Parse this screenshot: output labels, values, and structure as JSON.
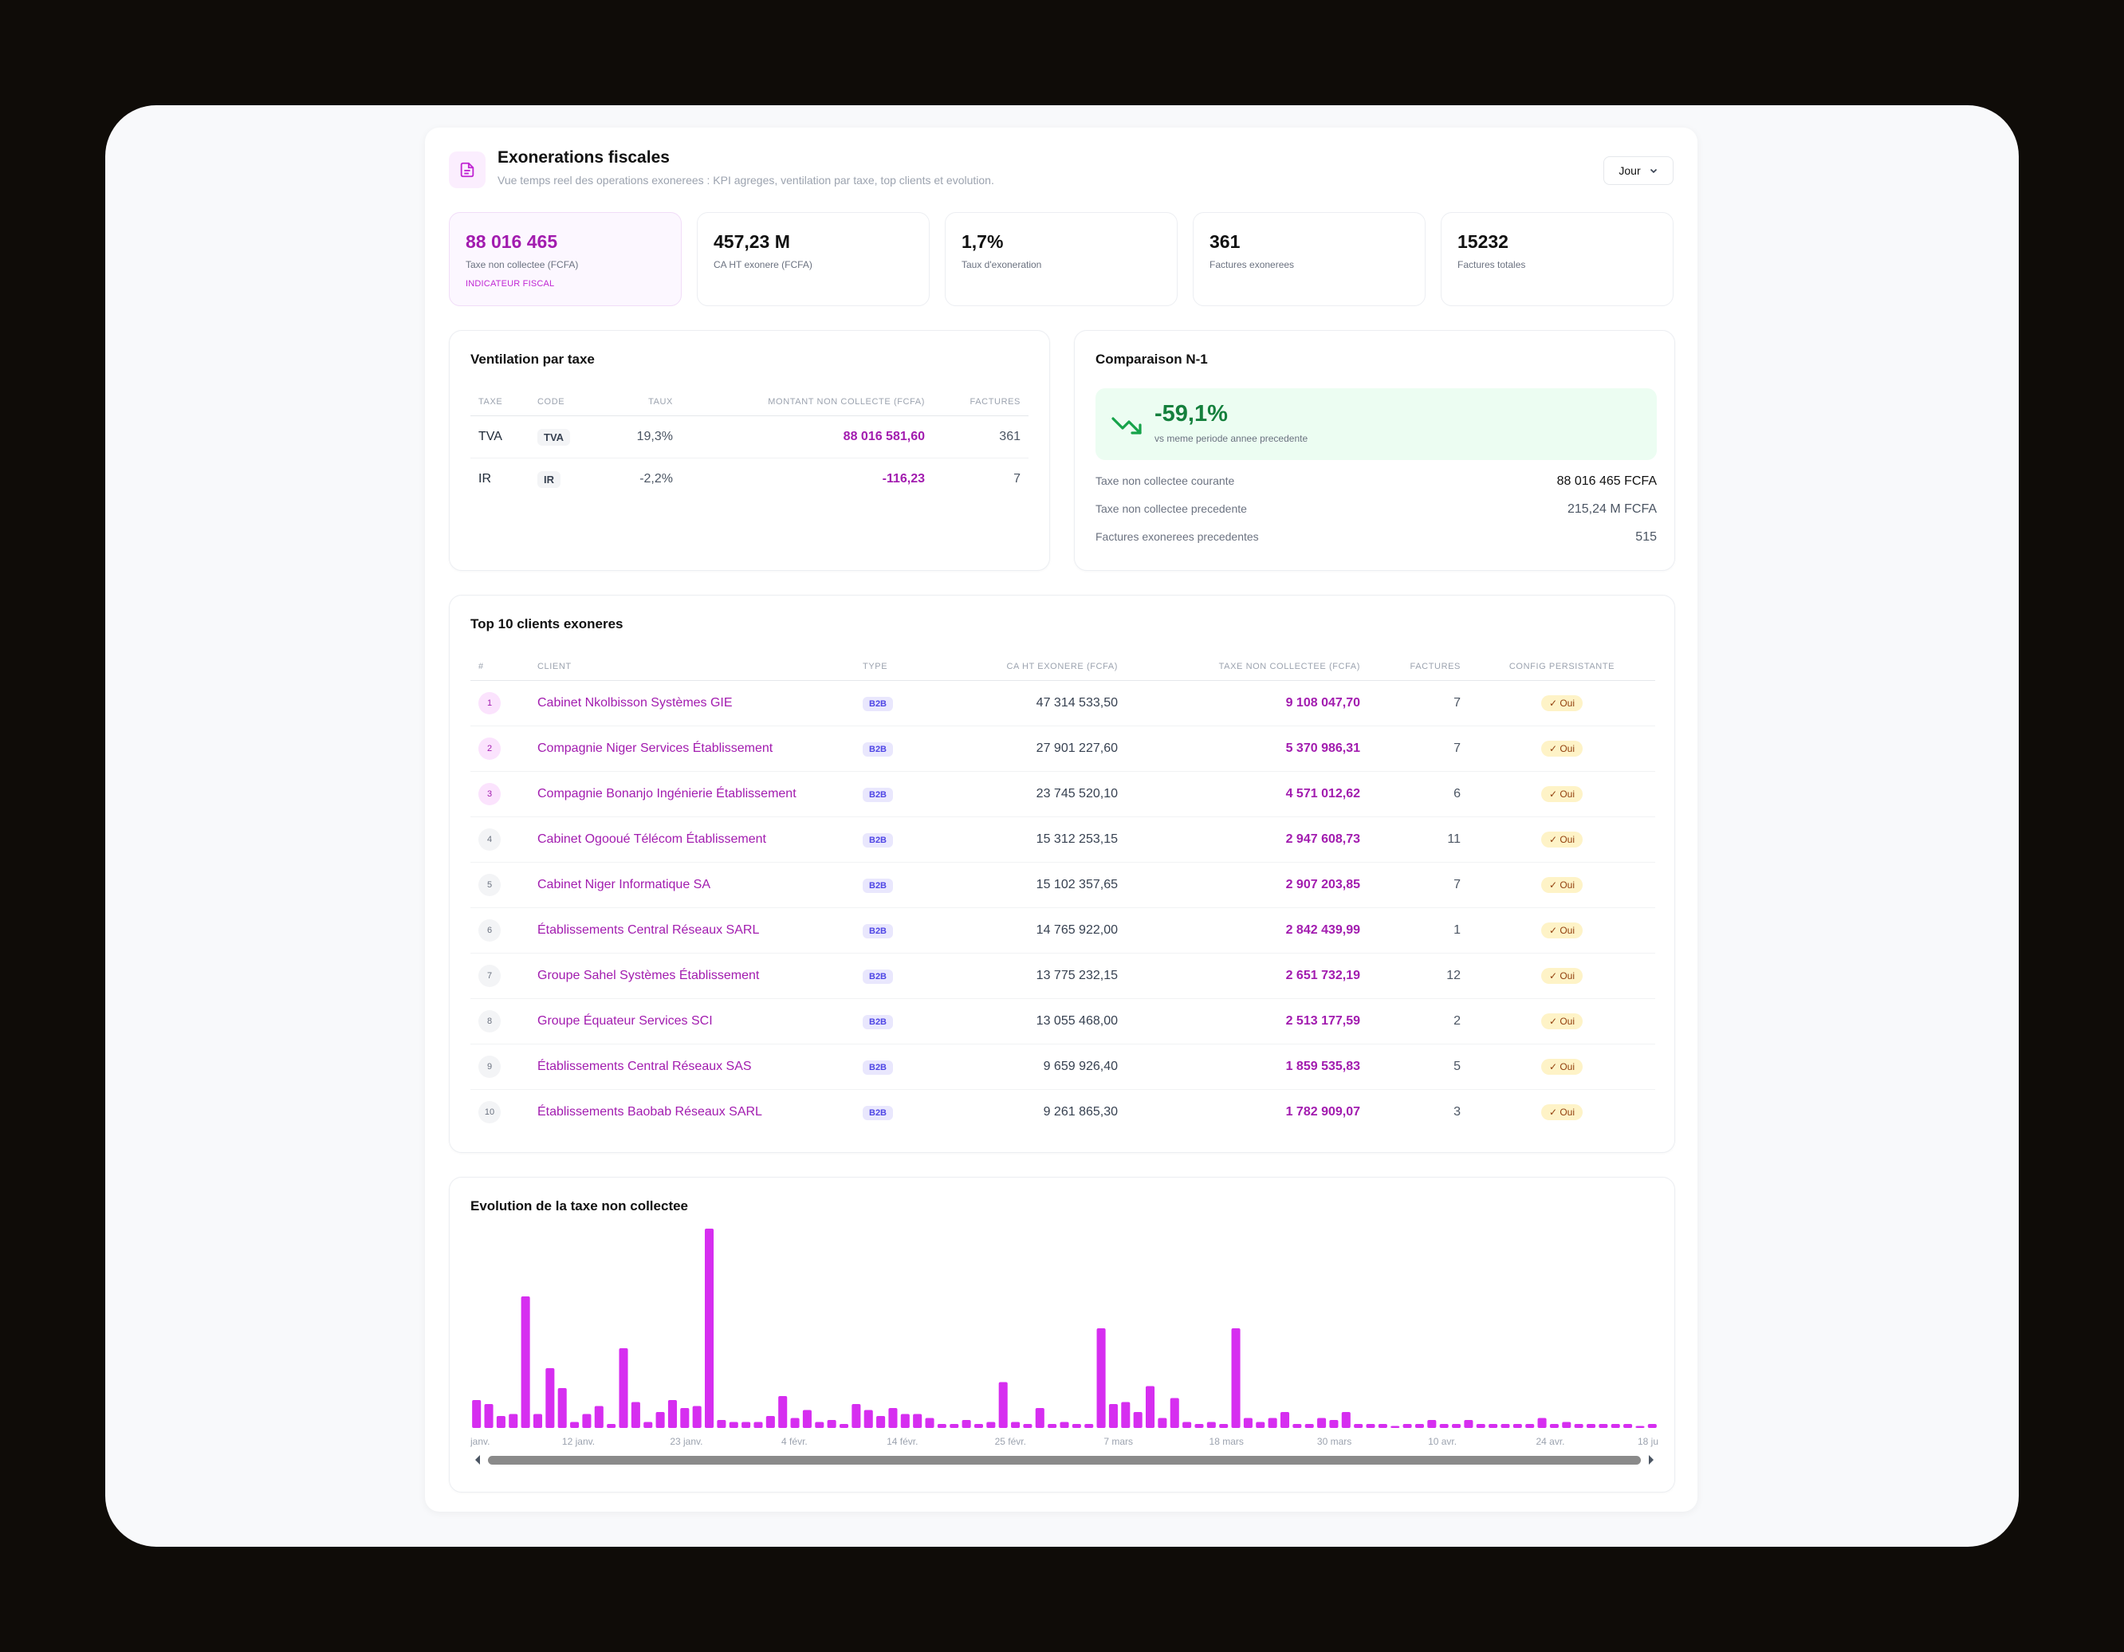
{
  "header": {
    "title": "Exonerations fiscales",
    "subtitle": "Vue temps reel des operations exonerees : KPI agreges, ventilation par taxe, top clients et evolution.",
    "period_select": "Jour"
  },
  "kpis": [
    {
      "value": "88 016 465",
      "label": "Taxe non collectee (FCFA)",
      "tag": "INDICATEUR FISCAL"
    },
    {
      "value": "457,23 M",
      "label": "CA HT exonere (FCFA)"
    },
    {
      "value": "1,7%",
      "label": "Taux d'exoneration"
    },
    {
      "value": "361",
      "label": "Factures exonerees"
    },
    {
      "value": "15232",
      "label": "Factures totales"
    }
  ],
  "ventilation": {
    "title": "Ventilation par taxe",
    "columns": [
      "TAXE",
      "CODE",
      "TAUX",
      "MONTANT NON COLLECTE (FCFA)",
      "FACTURES"
    ],
    "rows": [
      {
        "taxe": "TVA",
        "code": "TVA",
        "taux": "19,3%",
        "montant": "88 016 581,60",
        "factures": "361"
      },
      {
        "taxe": "IR",
        "code": "IR",
        "taux": "-2,2%",
        "montant": "-116,23",
        "factures": "7"
      }
    ]
  },
  "comparison": {
    "title": "Comparaison N-1",
    "delta": "-59,1%",
    "delta_sub": "vs meme periode annee precedente",
    "rows": [
      {
        "label": "Taxe non collectee courante",
        "value": "88 016 465 FCFA"
      },
      {
        "label": "Taxe non collectee precedente",
        "value": "215,24 M FCFA"
      },
      {
        "label": "Factures exonerees precedentes",
        "value": "515"
      }
    ]
  },
  "top_clients": {
    "title": "Top 10 clients exoneres",
    "columns": [
      "#",
      "CLIENT",
      "TYPE",
      "CA HT EXONERE (FCFA)",
      "TAXE NON COLLECTEE (FCFA)",
      "FACTURES",
      "CONFIG PERSISTANTE"
    ],
    "rows": [
      {
        "rank": "1",
        "client": "Cabinet Nkolbisson Systèmes GIE",
        "type": "B2B",
        "ca": "47 314 533,50",
        "taxe": "9 108 047,70",
        "factures": "7",
        "config": "Oui"
      },
      {
        "rank": "2",
        "client": "Compagnie Niger Services Établissement",
        "type": "B2B",
        "ca": "27 901 227,60",
        "taxe": "5 370 986,31",
        "factures": "7",
        "config": "Oui"
      },
      {
        "rank": "3",
        "client": "Compagnie Bonanjo Ingénierie Établissement",
        "type": "B2B",
        "ca": "23 745 520,10",
        "taxe": "4 571 012,62",
        "factures": "6",
        "config": "Oui"
      },
      {
        "rank": "4",
        "client": "Cabinet Ogooué Télécom Établissement",
        "type": "B2B",
        "ca": "15 312 253,15",
        "taxe": "2 947 608,73",
        "factures": "11",
        "config": "Oui"
      },
      {
        "rank": "5",
        "client": "Cabinet Niger Informatique SA",
        "type": "B2B",
        "ca": "15 102 357,65",
        "taxe": "2 907 203,85",
        "factures": "7",
        "config": "Oui"
      },
      {
        "rank": "6",
        "client": "Établissements Central Réseaux SARL",
        "type": "B2B",
        "ca": "14 765 922,00",
        "taxe": "2 842 439,99",
        "factures": "1",
        "config": "Oui"
      },
      {
        "rank": "7",
        "client": "Groupe Sahel Systèmes Établissement",
        "type": "B2B",
        "ca": "13 775 232,15",
        "taxe": "2 651 732,19",
        "factures": "12",
        "config": "Oui"
      },
      {
        "rank": "8",
        "client": "Groupe Équateur Services SCI",
        "type": "B2B",
        "ca": "13 055 468,00",
        "taxe": "2 513 177,59",
        "factures": "2",
        "config": "Oui"
      },
      {
        "rank": "9",
        "client": "Établissements Central Réseaux SAS",
        "type": "B2B",
        "ca": "9 659 926,40",
        "taxe": "1 859 535,83",
        "factures": "5",
        "config": "Oui"
      },
      {
        "rank": "10",
        "client": "Établissements Baobab Réseaux SARL",
        "type": "B2B",
        "ca": "9 261 865,30",
        "taxe": "1 782 909,07",
        "factures": "3",
        "config": "Oui"
      }
    ]
  },
  "evolution": {
    "title": "Evolution de la taxe non collectee"
  },
  "chart_data": {
    "type": "bar",
    "color": "#d62ef0",
    "x_tick_labels": [
      "janv.",
      "12 janv.",
      "23 janv.",
      "4 févr.",
      "14 févr.",
      "25 févr.",
      "7 mars",
      "18 mars",
      "30 mars",
      "10 avr.",
      "24 avr.",
      "18 ju"
    ],
    "values": [
      14,
      12,
      6,
      7,
      66,
      7,
      30,
      20,
      3,
      7,
      11,
      2,
      40,
      13,
      3,
      8,
      14,
      10,
      11,
      100,
      4,
      3,
      3,
      3,
      6,
      16,
      5,
      9,
      3,
      4,
      2,
      12,
      9,
      6,
      10,
      7,
      7,
      5,
      2,
      2,
      4,
      2,
      3,
      23,
      3,
      2,
      10,
      2,
      3,
      2,
      2,
      50,
      12,
      13,
      8,
      21,
      5,
      15,
      3,
      2,
      3,
      2,
      50,
      5,
      3,
      5,
      8,
      2,
      2,
      5,
      4,
      8,
      2,
      2,
      2,
      1,
      2,
      2,
      4,
      2,
      2,
      4,
      2,
      2,
      2,
      2,
      2,
      5,
      2,
      3,
      2,
      2,
      2,
      2,
      2,
      1,
      2
    ],
    "ylim": [
      0,
      100
    ],
    "grid": false,
    "scrollbar": true
  }
}
